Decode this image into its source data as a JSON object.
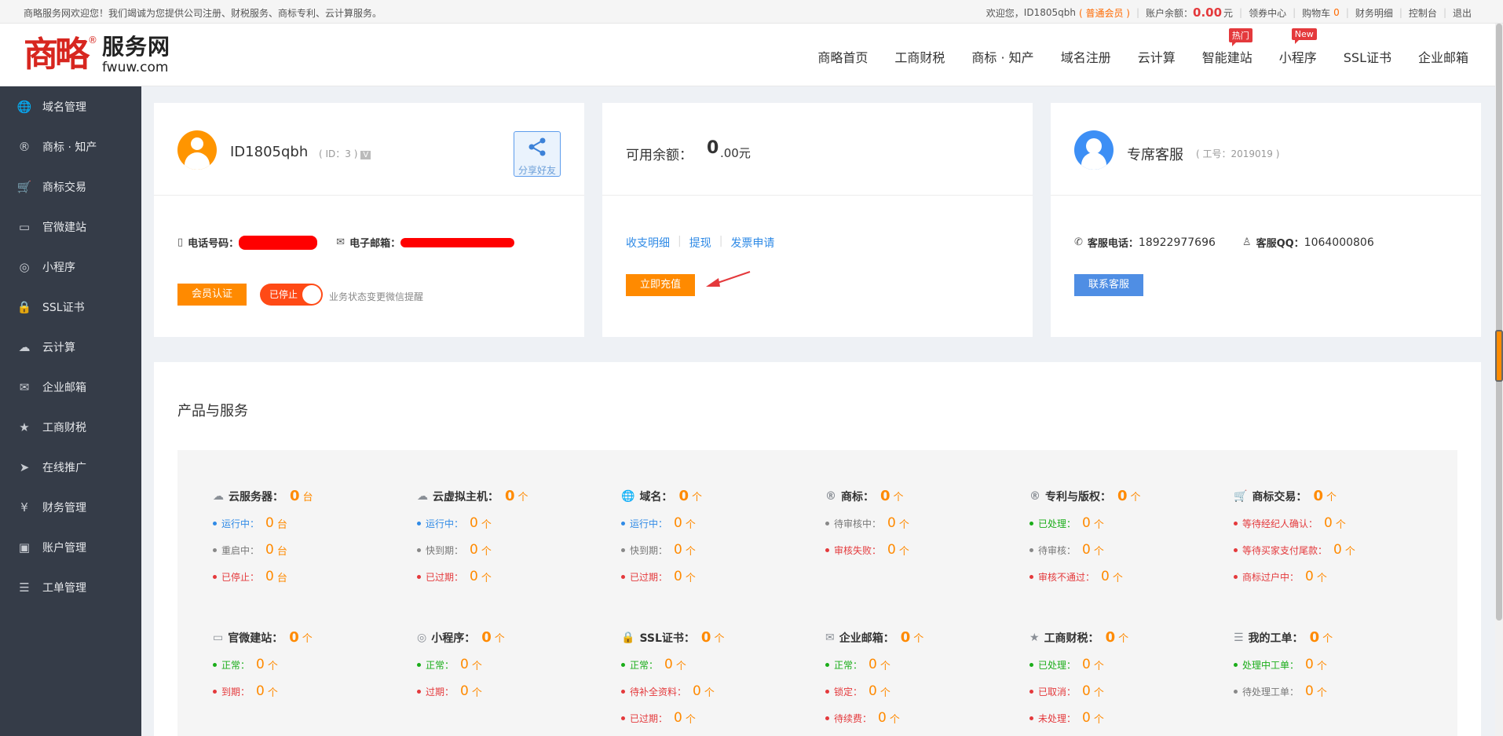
{
  "topbar": {
    "welcome": "商略服务网欢迎您！我们竭诚为您提供公司注册、财税服务、商标专利、云计算服务。",
    "greeting": "欢迎您，",
    "username": "ID1805qbh",
    "member": "( 普通会员 )",
    "balance_label": "账户余额：",
    "balance_value": "0.00",
    "balance_unit": "元",
    "coupon": "领券中心",
    "cart_label": "购物车",
    "cart_count": "0",
    "finance": "财务明细",
    "console": "控制台",
    "logout": "退出"
  },
  "logo": {
    "mark": "商略",
    "reg": "®",
    "cn": "服务网",
    "en": "fwuw.com"
  },
  "nav": [
    {
      "label": "商略首页",
      "badge": ""
    },
    {
      "label": "工商财税",
      "badge": ""
    },
    {
      "label": "商标 · 知产",
      "badge": ""
    },
    {
      "label": "域名注册",
      "badge": ""
    },
    {
      "label": "云计算",
      "badge": ""
    },
    {
      "label": "智能建站",
      "badge": "热门"
    },
    {
      "label": "小程序",
      "badge": "New"
    },
    {
      "label": "SSL证书",
      "badge": ""
    },
    {
      "label": "企业邮箱",
      "badge": ""
    }
  ],
  "sidebar": [
    {
      "label": "域名管理",
      "icon": "globe-icon",
      "glyph": "🌐"
    },
    {
      "label": "商标 · 知产",
      "icon": "registered-icon",
      "glyph": "®"
    },
    {
      "label": "商标交易",
      "icon": "cart-icon",
      "glyph": "🛒"
    },
    {
      "label": "官微建站",
      "icon": "monitor-icon",
      "glyph": "▭"
    },
    {
      "label": "小程序",
      "icon": "miniapp-icon",
      "glyph": "◎"
    },
    {
      "label": "SSL证书",
      "icon": "lock-icon",
      "glyph": "🔒"
    },
    {
      "label": "云计算",
      "icon": "cloud-server-icon",
      "glyph": "☁"
    },
    {
      "label": "企业邮箱",
      "icon": "mail-icon",
      "glyph": "✉"
    },
    {
      "label": "工商财税",
      "icon": "bookmark-icon",
      "glyph": "★"
    },
    {
      "label": "在线推广",
      "icon": "send-icon",
      "glyph": "➤"
    },
    {
      "label": "财务管理",
      "icon": "yen-icon",
      "glyph": "¥"
    },
    {
      "label": "账户管理",
      "icon": "account-icon",
      "glyph": "▣"
    },
    {
      "label": "工单管理",
      "icon": "clipboard-icon",
      "glyph": "☰"
    }
  ],
  "user_card": {
    "name": "ID1805qbh",
    "id_text": "( ID：3 )",
    "v_badge": "V",
    "share_label": "分享好友",
    "phone_label": "电话号码：",
    "email_label": "电子邮箱：",
    "verify_button": "会员认证",
    "toggle_label": "已停止",
    "hint": "业务状态变更微信提醒"
  },
  "balance_card": {
    "label": "可用余额：",
    "value": "0",
    "unit": ".00元",
    "link1": "收支明细",
    "link2": "提现",
    "link3": "发票申请",
    "recharge_button": "立即充值"
  },
  "service_card": {
    "name": "专席客服",
    "no": "( 工号：2019019 )",
    "phone_label": "客服电话：",
    "phone": "18922977696",
    "qq_label": "客服QQ：",
    "qq": "1064000806",
    "contact_button": "联系客服"
  },
  "products": {
    "title": "产品与服务",
    "cells": [
      {
        "title": "云服务器：",
        "icon": "cloud-server-icon",
        "glyph": "☁",
        "count": "0",
        "unit": "台",
        "rows": [
          {
            "label": "运行中：",
            "value": "0",
            "unit": "台",
            "color": "blue"
          },
          {
            "label": "重启中：",
            "value": "0",
            "unit": "台",
            "color": "gray"
          },
          {
            "label": "已停止：",
            "value": "0",
            "unit": "台",
            "color": "red"
          }
        ]
      },
      {
        "title": "云虚拟主机：",
        "icon": "cloud-server-icon",
        "glyph": "☁",
        "count": "0",
        "unit": "个",
        "rows": [
          {
            "label": "运行中：",
            "value": "0",
            "unit": "个",
            "color": "blue"
          },
          {
            "label": "快到期：",
            "value": "0",
            "unit": "个",
            "color": "gray"
          },
          {
            "label": "已过期：",
            "value": "0",
            "unit": "个",
            "color": "red"
          }
        ]
      },
      {
        "title": "域名：",
        "icon": "globe-icon",
        "glyph": "🌐",
        "count": "0",
        "unit": "个",
        "rows": [
          {
            "label": "运行中：",
            "value": "0",
            "unit": "个",
            "color": "blue"
          },
          {
            "label": "快到期：",
            "value": "0",
            "unit": "个",
            "color": "gray"
          },
          {
            "label": "已过期：",
            "value": "0",
            "unit": "个",
            "color": "red"
          }
        ]
      },
      {
        "title": "商标：",
        "icon": "registered-icon",
        "glyph": "®",
        "count": "0",
        "unit": "个",
        "rows": [
          {
            "label": "待审核中：",
            "value": "0",
            "unit": "个",
            "color": "gray"
          },
          {
            "label": "审核失败：",
            "value": "0",
            "unit": "个",
            "color": "red"
          }
        ]
      },
      {
        "title": "专利与版权：",
        "icon": "registered-icon",
        "glyph": "®",
        "count": "0",
        "unit": "个",
        "rows": [
          {
            "label": "已处理：",
            "value": "0",
            "unit": "个",
            "color": "green"
          },
          {
            "label": "待审核：",
            "value": "0",
            "unit": "个",
            "color": "gray"
          },
          {
            "label": "审核不通过：",
            "value": "0",
            "unit": "个",
            "color": "red"
          }
        ]
      },
      {
        "title": "商标交易：",
        "icon": "cart-icon",
        "glyph": "🛒",
        "count": "0",
        "unit": "个",
        "rows": [
          {
            "label": "等待经纪人确认：",
            "value": "0",
            "unit": "个",
            "color": "red"
          },
          {
            "label": "等待买家支付尾款：",
            "value": "0",
            "unit": "个",
            "color": "red"
          },
          {
            "label": "商标过户中：",
            "value": "0",
            "unit": "个",
            "color": "red"
          }
        ]
      },
      {
        "title": "官微建站：",
        "icon": "monitor-icon",
        "glyph": "▭",
        "count": "0",
        "unit": "个",
        "rows": [
          {
            "label": "正常：",
            "value": "0",
            "unit": "个",
            "color": "green"
          },
          {
            "label": "到期：",
            "value": "0",
            "unit": "个",
            "color": "red"
          }
        ]
      },
      {
        "title": "小程序：",
        "icon": "miniapp-icon",
        "glyph": "◎",
        "count": "0",
        "unit": "个",
        "rows": [
          {
            "label": "正常：",
            "value": "0",
            "unit": "个",
            "color": "green"
          },
          {
            "label": "过期：",
            "value": "0",
            "unit": "个",
            "color": "red"
          }
        ]
      },
      {
        "title": "SSL证书：",
        "icon": "lock-icon",
        "glyph": "🔒",
        "count": "0",
        "unit": "个",
        "rows": [
          {
            "label": "正常：",
            "value": "0",
            "unit": "个",
            "color": "green"
          },
          {
            "label": "待补全资料：",
            "value": "0",
            "unit": "个",
            "color": "red"
          },
          {
            "label": "已过期：",
            "value": "0",
            "unit": "个",
            "color": "red"
          }
        ]
      },
      {
        "title": "企业邮箱：",
        "icon": "mail-icon",
        "glyph": "✉",
        "count": "0",
        "unit": "个",
        "rows": [
          {
            "label": "正常：",
            "value": "0",
            "unit": "个",
            "color": "green"
          },
          {
            "label": "锁定：",
            "value": "0",
            "unit": "个",
            "color": "red"
          },
          {
            "label": "待续费：",
            "value": "0",
            "unit": "个",
            "color": "red"
          }
        ]
      },
      {
        "title": "工商财税：",
        "icon": "bookmark-icon",
        "glyph": "★",
        "count": "0",
        "unit": "个",
        "rows": [
          {
            "label": "已处理：",
            "value": "0",
            "unit": "个",
            "color": "green"
          },
          {
            "label": "已取消：",
            "value": "0",
            "unit": "个",
            "color": "red"
          },
          {
            "label": "未处理：",
            "value": "0",
            "unit": "个",
            "color": "red"
          }
        ]
      },
      {
        "title": "我的工单：",
        "icon": "clipboard-icon",
        "glyph": "☰",
        "count": "0",
        "unit": "个",
        "rows": [
          {
            "label": "处理中工单：",
            "value": "0",
            "unit": "个",
            "color": "green"
          },
          {
            "label": "待处理工单：",
            "value": "0",
            "unit": "个",
            "color": "gray"
          }
        ]
      }
    ]
  }
}
